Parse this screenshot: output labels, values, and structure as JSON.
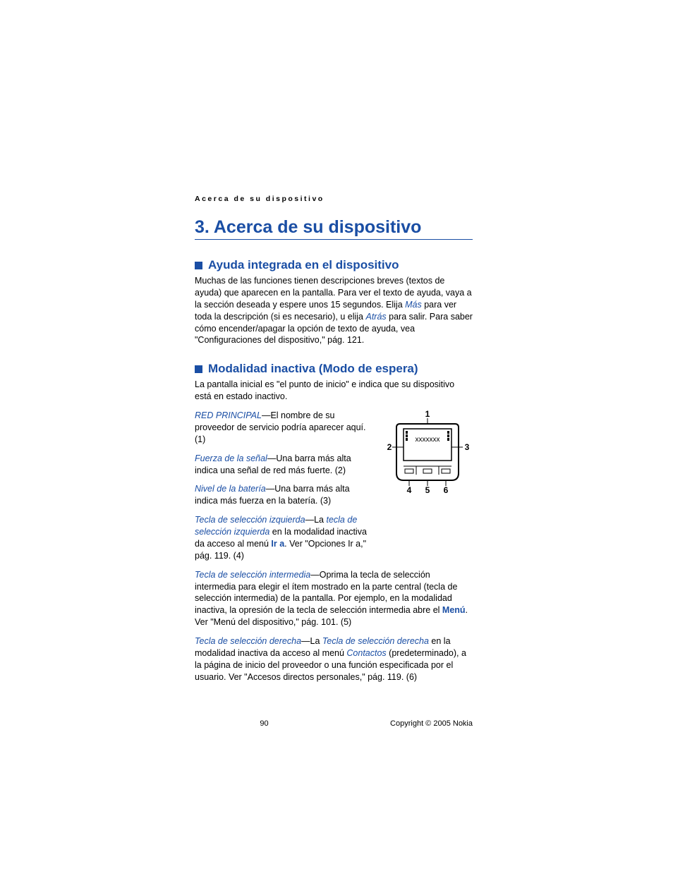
{
  "header": {
    "running": "Acerca de su dispositivo"
  },
  "chapter": {
    "title": "3.  Acerca de su dispositivo"
  },
  "section1": {
    "heading": "Ayuda integrada en el dispositivo",
    "p1a": "Muchas de las funciones tienen descripciones breves (textos de ayuda) que aparecen en la pantalla. Para ver el texto de ayuda, vaya a la sección deseada y espere unos 15 segundos. Elija ",
    "mas": "Más",
    "p1b": " para ver toda la descripción (si es necesario), u elija ",
    "atras": "Atrás",
    "p1c": " para salir. Para saber cómo encender/apagar la opción de texto de ayuda, vea \"Configuraciones del dispositivo,\" pág. 121."
  },
  "section2": {
    "heading": "Modalidad inactiva (Modo de espera)",
    "p_intro": "La pantalla inicial es \"el punto de inicio\" e indica que su dispositivo está en estado inactivo.",
    "item1": {
      "term": "RED PRINCIPAL",
      "rest": "—El nombre de su proveedor de servicio podría aparecer aquí. (1)"
    },
    "item2": {
      "term": "Fuerza de la señal",
      "rest": "—Una barra más alta indica una señal de red más fuerte. (2)"
    },
    "item3": {
      "term": "Nivel de la batería",
      "rest": "—Una barra más alta indica más fuerza en la batería. (3)"
    },
    "item4": {
      "term": "Tecla de selección izquierda",
      "mid1": "—La ",
      "link": "tecla de selección izquierda",
      "mid2": " en la modalidad inactiva da acceso al menú ",
      "bold": "Ir a",
      "rest": ". Ver \"Opciones Ir a,\" pág. 119. (4)"
    },
    "item5": {
      "term": "Tecla de selección intermedia",
      "mid1": "—Oprima la tecla de selección intermedia para elegir el ítem mostrado en la parte central (tecla de selección intermedia) de la pantalla. Por ejemplo, en la modalidad inactiva, la opresión de la tecla de selección intermedia abre el ",
      "bold": "Menú",
      "rest": ". Ver \"Menú del dispositivo,\" pág. 101. (5)"
    },
    "item6": {
      "term": "Tecla de selección derecha",
      "mid1": "—La ",
      "link1": "Tecla de selección derecha",
      "mid2": " en la modalidad inactiva da acceso al menú ",
      "link2": "Contactos",
      "rest": " (predeterminado), a la página de inicio del proveedor o una función especificada por el usuario. Ver \"Accesos directos personales,\" pág. 119. (6)"
    }
  },
  "diagram": {
    "label1": "1",
    "label2": "2",
    "label3": "3",
    "label4": "4",
    "label5": "5",
    "label6": "6",
    "screen_text": "xxxxxxx"
  },
  "footer": {
    "page": "90",
    "copyright": "Copyright © 2005 Nokia"
  }
}
